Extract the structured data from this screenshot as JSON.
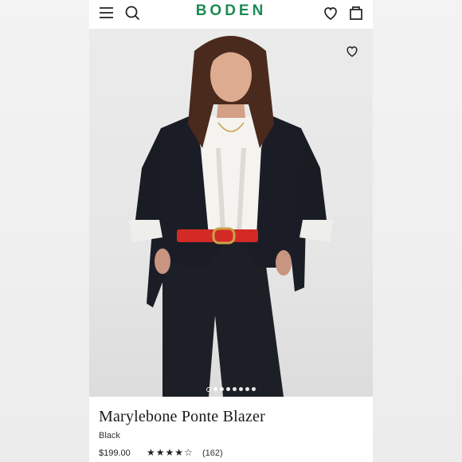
{
  "brand": {
    "logo_text": "BODEN",
    "accent_color": "#1c8a52"
  },
  "header": {
    "menu_icon": "hamburger-menu-icon",
    "search_icon": "search-icon",
    "wishlist_icon": "heart-icon",
    "bag_icon": "shopping-bag-icon"
  },
  "gallery": {
    "wishlist_icon": "heart-outline-icon",
    "slide_count": 8,
    "active_slide": 1
  },
  "product": {
    "name": "Marylebone Ponte Blazer",
    "color": "Black",
    "price": "$199.00",
    "rating_stars": "★★★★☆",
    "rating_value": 4.5,
    "review_count": "(162)"
  }
}
